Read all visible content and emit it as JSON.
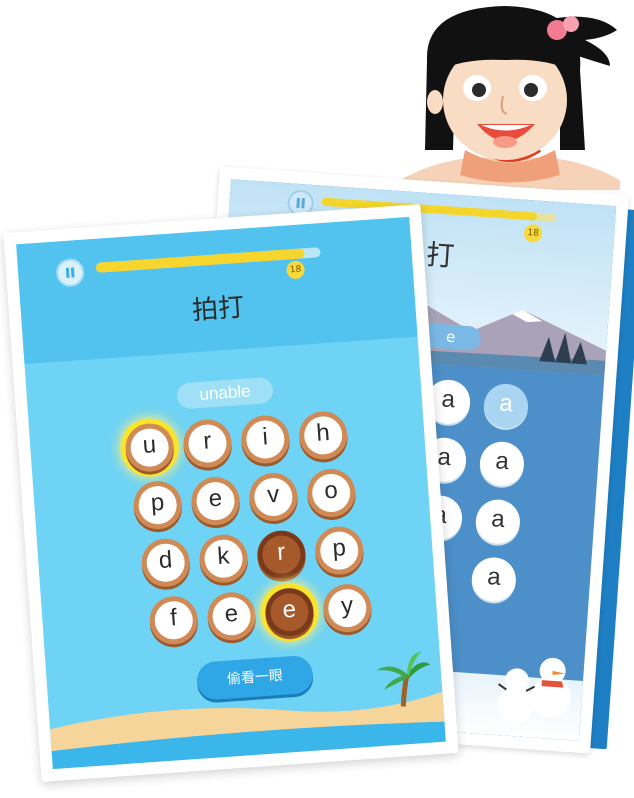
{
  "back_card": {
    "title": "打",
    "word_chip": "e",
    "level": "18",
    "progress": 0.92,
    "tiles": [
      "a",
      "a",
      "a",
      "a",
      "a",
      "a",
      "a",
      "a",
      "a"
    ]
  },
  "front_card": {
    "title": "拍打",
    "word_chip": "unable",
    "level": "18",
    "progress": 0.93,
    "tiles": [
      [
        "u",
        "r",
        "i",
        "h"
      ],
      [
        "p",
        "e",
        "v",
        "o"
      ],
      [
        "d",
        "k",
        "r",
        "p"
      ],
      [
        "f",
        "e",
        "e",
        "y"
      ]
    ],
    "peek_button": "偷看一眼"
  },
  "colors": {
    "sky": "#52c3ef",
    "tile_wood": "#d08a55",
    "tile_selected": "#7a3a1a",
    "glow": "#fbe42a",
    "button": "#2fa6e6",
    "progress": "#f6d52c"
  }
}
